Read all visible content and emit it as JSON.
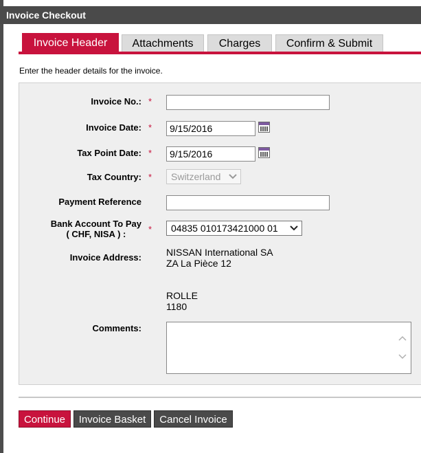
{
  "window": {
    "title": "Invoice Checkout"
  },
  "tabs": [
    {
      "label": "Invoice Header",
      "active": true
    },
    {
      "label": "Attachments",
      "active": false
    },
    {
      "label": "Charges",
      "active": false
    },
    {
      "label": "Confirm & Submit",
      "active": false
    }
  ],
  "intro_text": "Enter the header details for the invoice.",
  "form": {
    "required_marker": "*",
    "invoice_no": {
      "label": "Invoice No.:",
      "value": ""
    },
    "invoice_date": {
      "label": "Invoice Date:",
      "value": "9/15/2016",
      "icon": "calendar-icon"
    },
    "tax_point_date": {
      "label": "Tax Point Date:",
      "value": "9/15/2016",
      "icon": "calendar-icon"
    },
    "tax_country": {
      "label": "Tax Country:",
      "value": "Switzerland",
      "disabled": true
    },
    "payment_reference": {
      "label": "Payment Reference",
      "value": ""
    },
    "bank_account": {
      "label_line1": "Bank Account To Pay",
      "label_line2": "( CHF, NISA ) :",
      "value": "04835 010173421000 01"
    },
    "invoice_address": {
      "label": "Invoice Address:",
      "line1": "NISSAN International SA",
      "line2": "ZA La Pièce 12",
      "line3": "ROLLE",
      "line4": "1180"
    },
    "comments": {
      "label": "Comments:",
      "value": ""
    }
  },
  "buttons": {
    "continue": "Continue",
    "invoice_basket": "Invoice Basket",
    "cancel_invoice": "Cancel Invoice"
  },
  "colors": {
    "accent": "#c8133d",
    "titlebar": "#4a4a4a",
    "panel": "#efefef"
  }
}
